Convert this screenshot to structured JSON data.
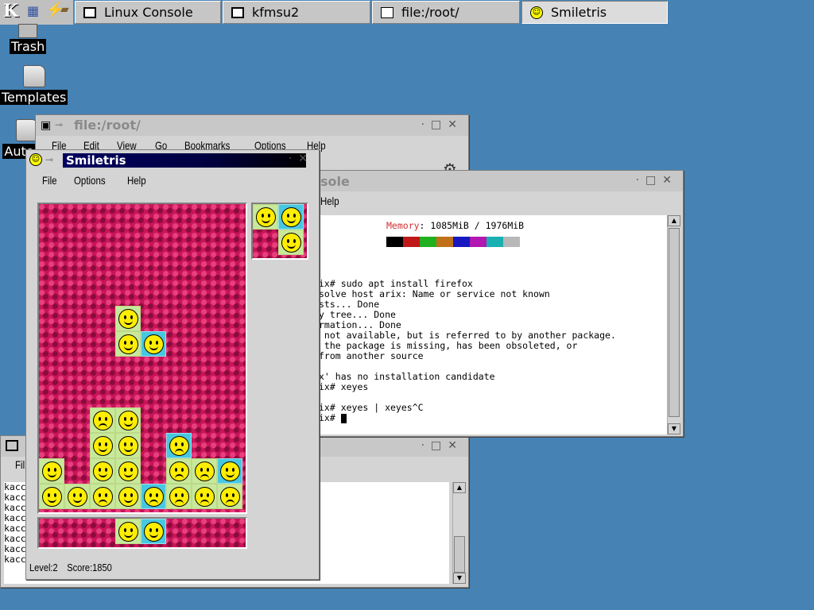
{
  "taskbar": {
    "tasks": [
      {
        "label": "Linux Console",
        "icon": "console-icon"
      },
      {
        "label": "kfmsu2",
        "icon": "console-icon"
      },
      {
        "label": "file:/root/",
        "icon": "konqueror-icon"
      },
      {
        "label": "Smiletris",
        "icon": "smiley-icon",
        "active": true
      }
    ]
  },
  "desktop": {
    "icons": [
      {
        "label": "Trash"
      },
      {
        "label": "Templates"
      },
      {
        "label": "Auto"
      }
    ]
  },
  "filemanager": {
    "title": "file:/root/",
    "menu": [
      "File",
      "Edit",
      "View",
      "Go",
      "Bookmarks",
      "Options",
      "Help"
    ]
  },
  "console": {
    "title": "sole",
    "menu": [
      "Help"
    ],
    "memory_label": "Memory",
    "memory_value": ": 1085MiB / 1976MiB",
    "palette": [
      "#000000",
      "#c01818",
      "#20b020",
      "#c07018",
      "#1818c0",
      "#b018b0",
      "#18b0b0",
      "#b8b8b8"
    ],
    "lines": [
      "",
      "ix# sudo apt install firefox",
      "solve host arix: Name or service not known",
      "sts... Done",
      "y tree... Done",
      "rmation... Done",
      " not available, but is referred to by another package.",
      " the package is missing, has been obsoleted, or",
      "from another source",
      "",
      "x' has no installation candidate",
      "ix# xeyes",
      "",
      "ix# xeyes | xeyes^C",
      "ix# "
    ]
  },
  "kfmsu2": {
    "menu_fragment": "Fil",
    "lines": [
      "kacc",
      "kacc",
      "kacc",
      "kacc",
      "kacc",
      "kacc",
      "kacc",
      "kacc"
    ]
  },
  "smiletris": {
    "title": "Smiletris",
    "menu": [
      "File",
      "Options",
      "Help"
    ],
    "level_text": "Level:2",
    "score_text": "Score:1850",
    "level": 2,
    "score": 1850
  },
  "colors": {
    "desktop": "#4682b4",
    "board": "#c8145a",
    "block_green": "#c8e89a",
    "block_cyan": "#48c8e0",
    "face": "#ffee00"
  }
}
